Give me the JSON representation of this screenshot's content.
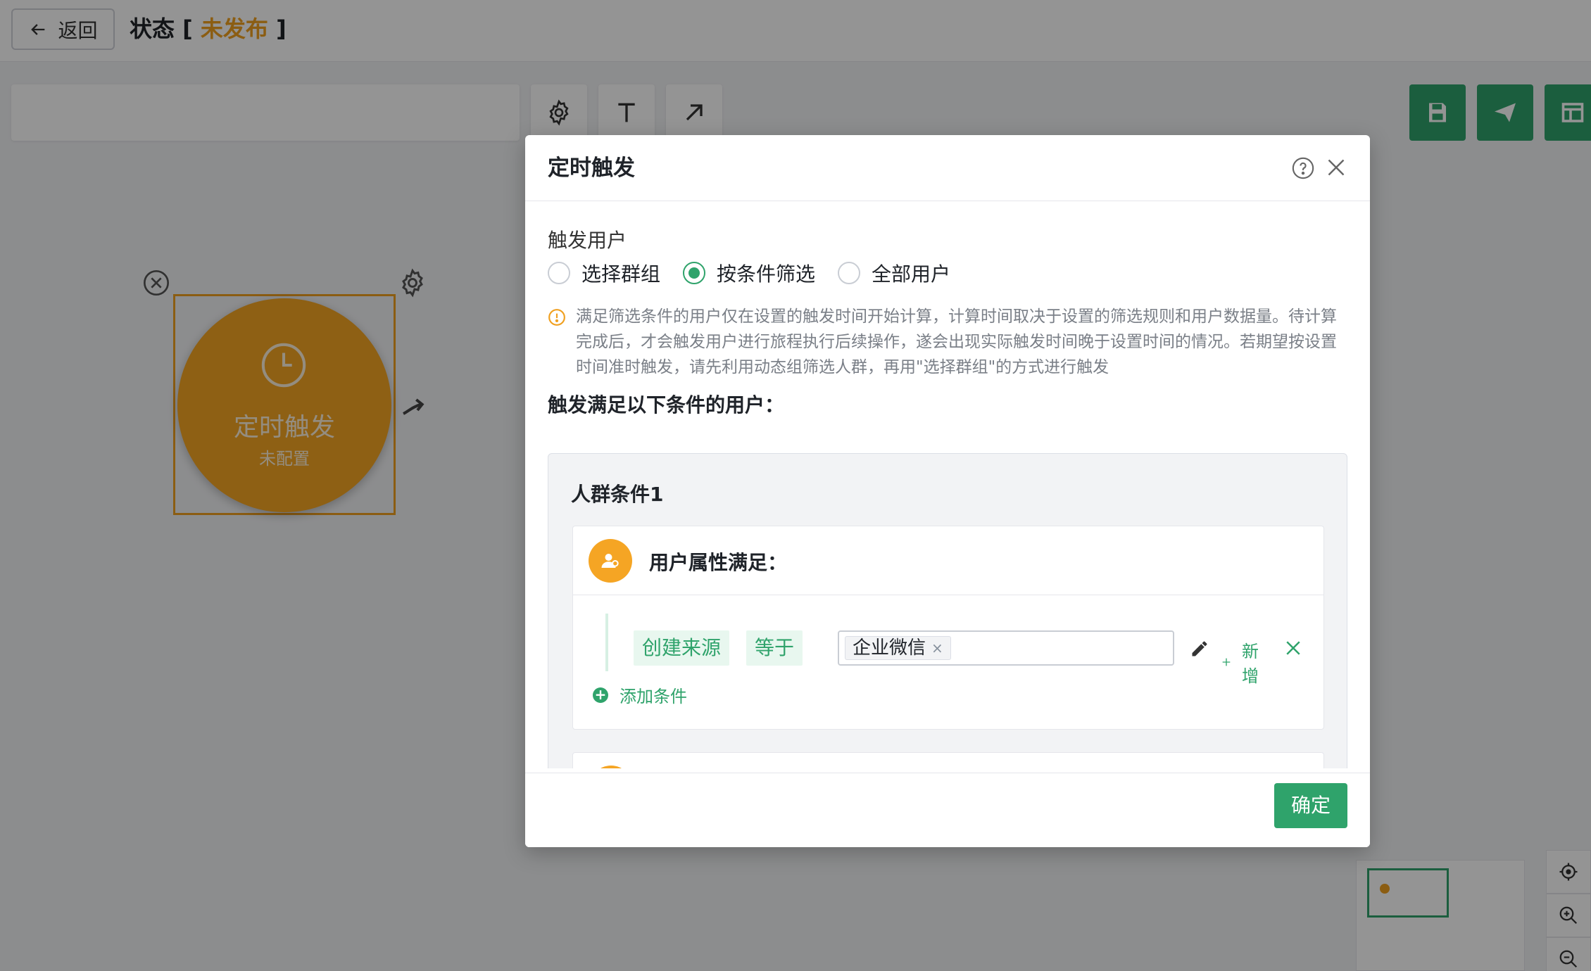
{
  "header": {
    "back_label": "返回",
    "status_prefix": "状态 [ ",
    "status_value": "未发布",
    "status_suffix": " ]"
  },
  "canvas": {
    "node": {
      "title": "定时触发",
      "subtitle": "未配置",
      "color": "#f5a524"
    }
  },
  "modal": {
    "title": "定时触发",
    "trigger_user_label": "触发用户",
    "radios": [
      {
        "label": "选择群组",
        "checked": false
      },
      {
        "label": "按条件筛选",
        "checked": true
      },
      {
        "label": "全部用户",
        "checked": false
      }
    ],
    "warning": "满足筛选条件的用户仅在设置的触发时间开始计算，计算时间取决于设置的筛选规则和用户数据量。待计算完成后，才会触发用户进行旅程执行后续操作，遂会出现实际触发时间晚于设置时间的情况。若期望按设置时间准时触发，请先利用动态组筛选人群，再用\"选择群组\"的方式进行触发",
    "condition_title": "触发满足以下条件的用户：",
    "group": {
      "title": "人群条件1",
      "attr_title": "用户属性满足：",
      "condition": {
        "field": "创建来源",
        "operator": "等于",
        "value": "企业微信",
        "add_label": "新增"
      },
      "add_condition_label": "添加条件"
    },
    "confirm_label": "确定"
  },
  "colors": {
    "accent": "#2fa36b",
    "node": "#f5a524",
    "status": "#f0a020"
  }
}
